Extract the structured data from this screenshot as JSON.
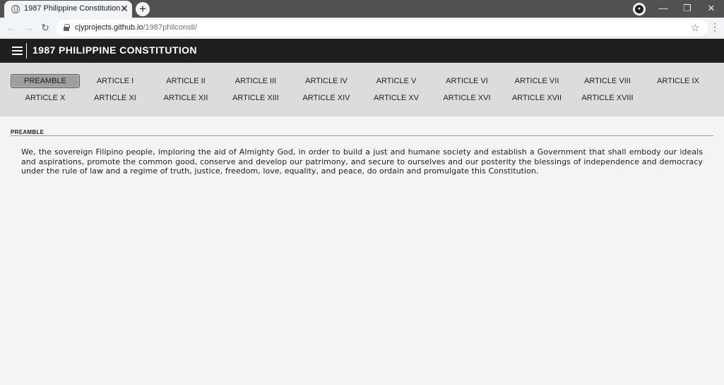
{
  "browser": {
    "tab_title": "1987 Philippine Constitution",
    "tab_close": "✕",
    "new_tab": "+",
    "url_host": "cjyprojects.github.io",
    "url_path": "/1987philconsti/",
    "icons": {
      "favicon": "globe-icon",
      "lock": "lock-icon",
      "star": "star-icon",
      "menu": "more-vert-icon"
    },
    "window_controls": {
      "minimize": "—",
      "restore": "❐",
      "close": "✕"
    }
  },
  "header": {
    "title": "1987 PHILIPPINE CONSTITUTION",
    "menu_icon": "hamburger-icon"
  },
  "articles": {
    "active": "PREAMBLE",
    "items": [
      "PREAMBLE",
      "ARTICLE I",
      "ARTICLE II",
      "ARTICLE III",
      "ARTICLE IV",
      "ARTICLE V",
      "ARTICLE VI",
      "ARTICLE VII",
      "ARTICLE VIII",
      "ARTICLE IX",
      "ARTICLE X",
      "ARTICLE XI",
      "ARTICLE XII",
      "ARTICLE XIII",
      "ARTICLE XIV",
      "ARTICLE XV",
      "ARTICLE XVI",
      "ARTICLE XVII",
      "ARTICLE XVIII"
    ]
  },
  "content": {
    "heading": "PREAMBLE",
    "text": "We, the sovereign Filipino people, imploring the aid of Almighty God, in order to build a just and humane society and establish a Government that shall embody our ideals and aspirations, promote the common good, conserve and develop our patrimony, and secure to ourselves and our posterity the blessings of independence and democracy under the rule of law and a regime of truth, justice, freedom, love, equality, and peace, do ordain and promulgate this Constitution."
  },
  "colors": {
    "header_bg": "#1e1e1e",
    "nav_bg": "#dcdcdc",
    "page_bg": "#f4f4f4",
    "active_button_bg": "#9e9e9e"
  }
}
